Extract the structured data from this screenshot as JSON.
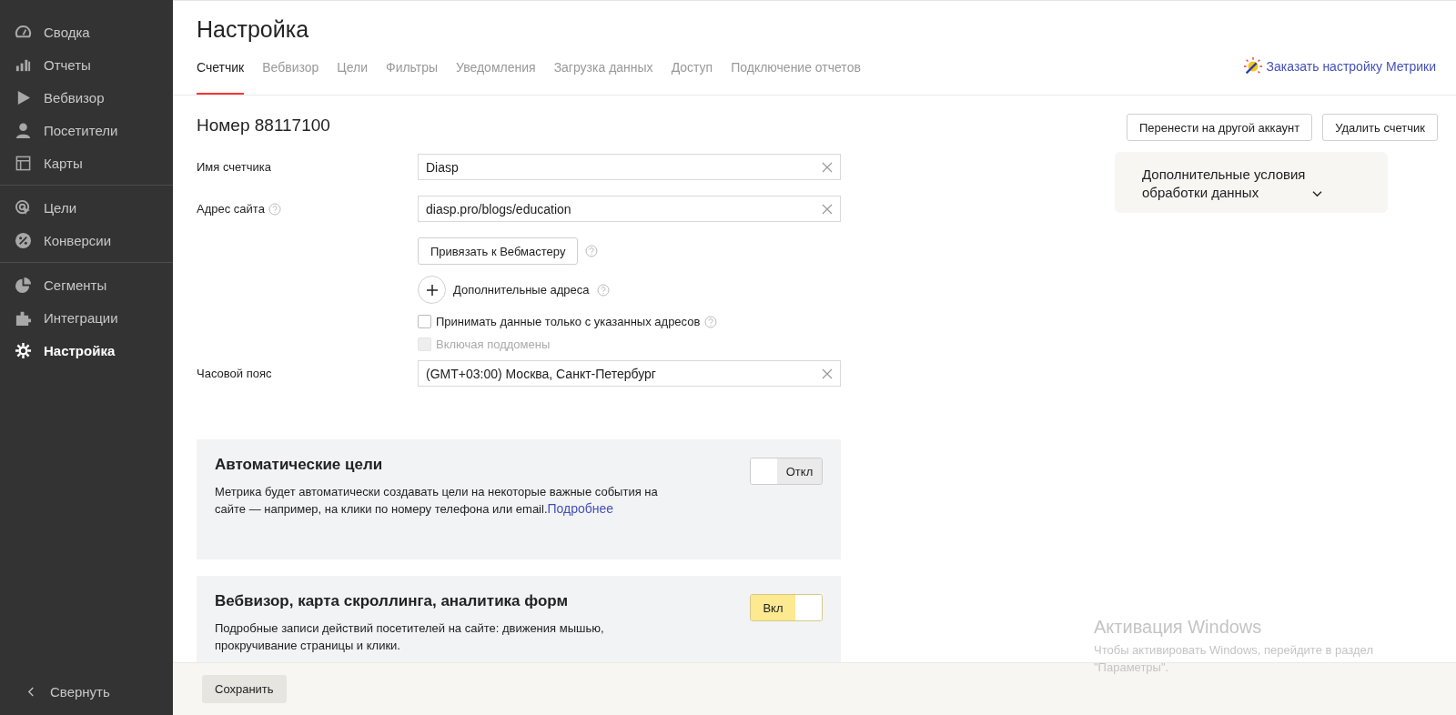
{
  "sidebar": {
    "groups": [
      [
        {
          "label": "Сводка",
          "selected": false
        },
        {
          "label": "Отчеты",
          "selected": false
        },
        {
          "label": "Вебвизор",
          "selected": false
        },
        {
          "label": "Посетители",
          "selected": false
        },
        {
          "label": "Карты",
          "selected": false
        }
      ],
      [
        {
          "label": "Цели",
          "selected": false
        },
        {
          "label": "Конверсии",
          "selected": false
        }
      ],
      [
        {
          "label": "Сегменты",
          "selected": false
        },
        {
          "label": "Интеграции",
          "selected": false
        },
        {
          "label": "Настройка",
          "selected": true
        }
      ]
    ],
    "collapse": "Свернуть"
  },
  "page": {
    "title": "Настройка",
    "order_link": "Заказать настройку Метрики"
  },
  "tabs": [
    {
      "label": "Счетчик",
      "selected": true
    },
    {
      "label": "Вебвизор",
      "selected": false
    },
    {
      "label": "Цели",
      "selected": false
    },
    {
      "label": "Фильтры",
      "selected": false
    },
    {
      "label": "Уведомления",
      "selected": false
    },
    {
      "label": "Загрузка данных",
      "selected": false
    },
    {
      "label": "Доступ",
      "selected": false
    },
    {
      "label": "Подключение отчетов",
      "selected": false
    }
  ],
  "counter": {
    "heading": "Номер 88117100",
    "name_field": {
      "label": "Имя счетчика",
      "value": "Diasp"
    },
    "site_field": {
      "label": "Адрес сайта",
      "value": "diasp.pro/blogs/education"
    },
    "webmaster_button": "Привязать к Вебмастеру",
    "extra_addresses": "Дополнительные адреса",
    "checkboxes": [
      {
        "label": "Принимать данные только с указанных адресов",
        "checked": false,
        "disabled": false,
        "help": true
      },
      {
        "label": "Включая поддомены",
        "checked": false,
        "disabled": true,
        "help": false
      }
    ],
    "timezone_field": {
      "label": "Часовой пояс",
      "value": "(GMT+03:00) Москва, Санкт-Петербург"
    }
  },
  "actions": [
    "Перенести на другой аккаунт",
    "Удалить счетчик"
  ],
  "extra_conditions": {
    "label": "Дополнительные условия обработки данных",
    "expanded": false
  },
  "cards": [
    {
      "title": "Автоматические цели",
      "text": "Метрика будет автоматически создавать цели на некоторые важные события на сайте — например, на клики по номеру телефона или email.",
      "link": "Подробнее",
      "toggle": {
        "on": false,
        "label": "Откл"
      }
    },
    {
      "title": "Вебвизор, карта скроллинга, аналитика форм",
      "text": "Подробные записи действий посетителей на сайте: движения мышью, прокручивание страницы и клики.",
      "toggle": {
        "on": true,
        "label": "Вкл"
      }
    }
  ],
  "save_button": "Сохранить",
  "os_notice": {
    "title": "Активация Windows",
    "text": "Чтобы активировать Windows, перейдите в раздел \"Параметры\"."
  }
}
